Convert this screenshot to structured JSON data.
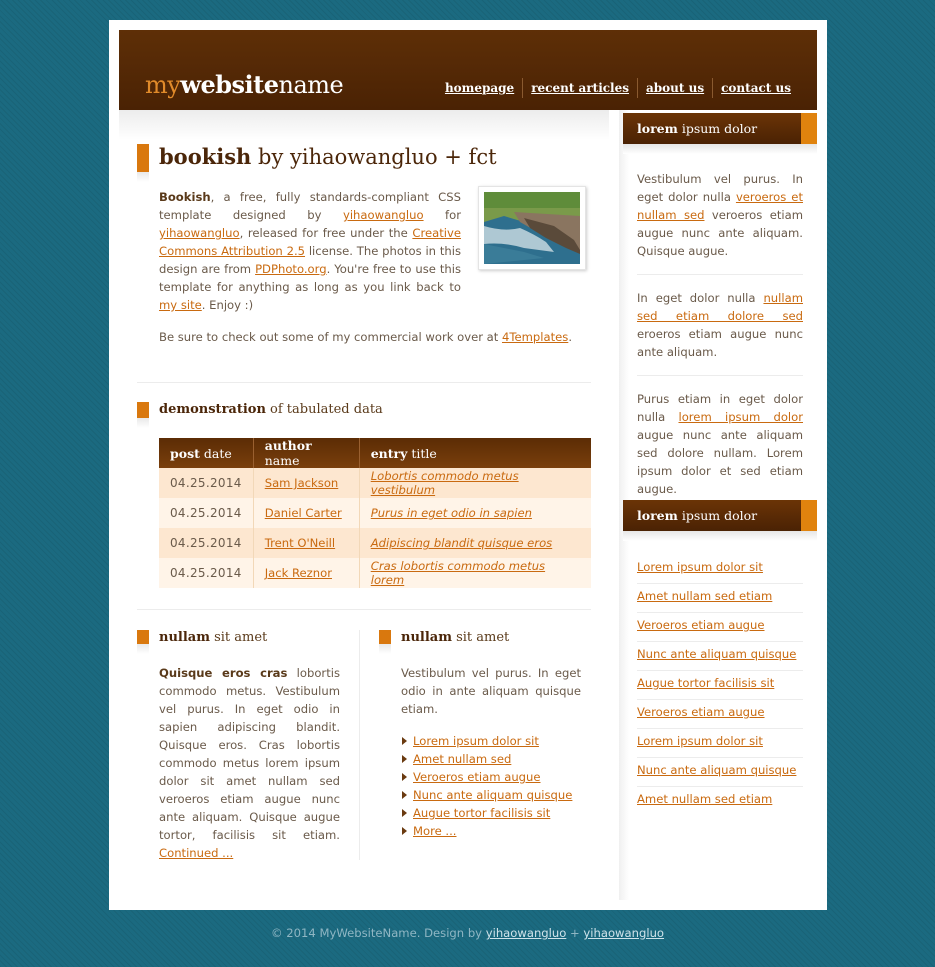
{
  "header": {
    "logo": {
      "part1": "my",
      "part2": "website",
      "part3": "name"
    },
    "nav": [
      "homepage",
      "recent articles",
      "about us",
      "contact us"
    ]
  },
  "main": {
    "title": {
      "bold": "bookish",
      "rest": " by yihaowangluo + fct"
    },
    "intro": {
      "bold": "Bookish",
      "t1": ", a free, fully standards-compliant CSS template designed by ",
      "link1": "yihaowangluo",
      "t2": " for ",
      "link2": "yihaowangluo",
      "t3": ", released for free under the ",
      "link3": "Creative Commons Attribution 2.5",
      "t4": " license. The photos in this design are from ",
      "link4": "PDPhoto.org",
      "t5": ". You're free to use this template for anything as long as you link back to ",
      "link5": "my site",
      "t6": ". Enjoy :)"
    },
    "commercial": {
      "t1": "Be sure to check out some of my commercial work over at ",
      "link": "4Templates",
      "t2": "."
    },
    "demo_heading": {
      "bold": "demonstration",
      "rest": " of tabulated data"
    },
    "table": {
      "headers": [
        {
          "bold": "post",
          "rest": " date"
        },
        {
          "bold": "author",
          "rest": " name"
        },
        {
          "bold": "entry",
          "rest": " title"
        }
      ],
      "rows": [
        {
          "date": "04.25.2014",
          "author": "Sam Jackson",
          "title": "Lobortis commodo metus vestibulum"
        },
        {
          "date": "04.25.2014",
          "author": "Daniel Carter",
          "title": "Purus in eget odio in sapien"
        },
        {
          "date": "04.25.2014",
          "author": "Trent O'Neill",
          "title": "Adipiscing blandit quisque eros"
        },
        {
          "date": "04.25.2014",
          "author": "Jack Reznor",
          "title": "Cras lobortis commodo metus lorem"
        }
      ]
    },
    "col1": {
      "heading": {
        "bold": "nullam",
        "rest": " sit amet"
      },
      "bold": "Quisque eros cras",
      "text": " lobortis commodo metus. Vestibulum vel purus. In eget odio in sapien adipiscing blandit. Quisque eros. Cras lobortis commodo metus lorem ipsum dolor sit amet nullam sed veroeros etiam augue nunc ante aliquam. Quisque augue tortor, facilisis sit etiam. ",
      "link": "Continued ..."
    },
    "col2": {
      "heading": {
        "bold": "nullam",
        "rest": " sit amet"
      },
      "text": "Vestibulum vel purus. In eget odio in ante aliquam quisque etiam.",
      "links": [
        "Lorem ipsum dolor sit",
        "Amet nullam sed",
        "Veroeros etiam augue",
        "Nunc ante aliquam quisque",
        "Augue tortor facilisis sit",
        "More ..."
      ]
    }
  },
  "sidebar": {
    "box1": {
      "heading": {
        "bold": "lorem",
        "rest": " ipsum dolor"
      },
      "p1": {
        "t1": "Vestibulum vel purus. In eget dolor nulla ",
        "link": "veroeros et nullam sed",
        "t2": " veroeros etiam augue nunc ante aliquam. Quisque augue."
      },
      "p2": {
        "t1": "In eget dolor nulla ",
        "link": "nullam sed etiam dolore sed",
        "t2": " eroeros etiam augue nunc ante aliquam."
      },
      "p3": {
        "t1": "Purus etiam in eget dolor nulla ",
        "link": "lorem ipsum dolor",
        "t2": " augue nunc ante aliquam sed dolore nullam. Lorem ipsum dolor et sed etiam augue."
      }
    },
    "box2": {
      "heading": {
        "bold": "lorem",
        "rest": " ipsum dolor"
      },
      "links": [
        "Lorem ipsum dolor sit",
        "Amet nullam sed etiam",
        "Veroeros etiam augue",
        "Nunc ante aliquam quisque",
        "Augue tortor facilisis sit",
        "Veroeros etiam augue",
        "Lorem ipsum dolor sit",
        "Nunc ante aliquam quisque",
        "Amet nullam sed etiam"
      ]
    }
  },
  "footer": {
    "text1": "© 2014 MyWebsiteName. Design by ",
    "link1": "yihaowangluo",
    "text2": " + ",
    "link2": "yihaowangluo"
  }
}
